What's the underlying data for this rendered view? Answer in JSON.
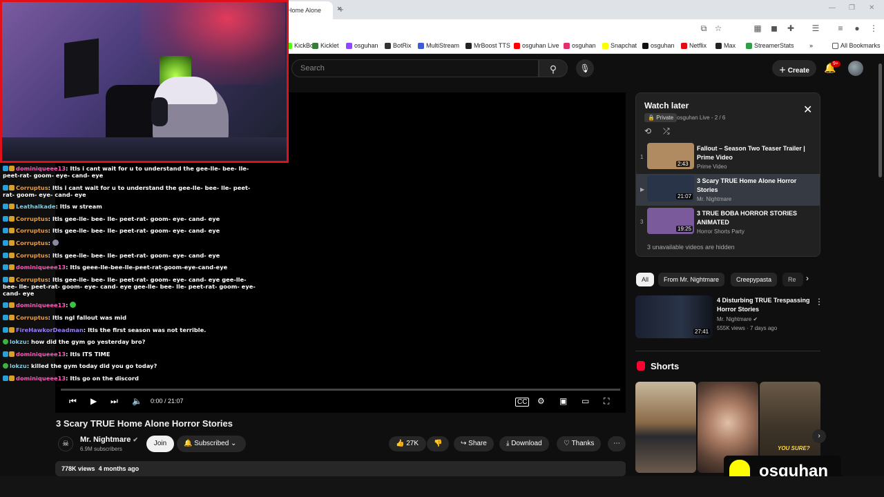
{
  "browser": {
    "tab_title": "Home Alone",
    "tab_close": "×",
    "new_tab": "+",
    "window_controls": [
      "—",
      "❐",
      "✕"
    ],
    "all_bookmarks": "All Bookmarks",
    "bookmarks": [
      {
        "label": "KickBot",
        "color": "#53fc18"
      },
      {
        "label": "Kicklet",
        "color": "#3a7a3a"
      },
      {
        "label": "osguhan",
        "color": "#9146ff"
      },
      {
        "label": "BotRix",
        "color": "#333333"
      },
      {
        "label": "MultiStream",
        "color": "#3b5bdb"
      },
      {
        "label": "MrBoost TTS",
        "color": "#222222"
      },
      {
        "label": "osguhan Live",
        "color": "#ff0000"
      },
      {
        "label": "osguhan",
        "color": "#e1306c"
      },
      {
        "label": "Snapchat",
        "color": "#fffc00"
      },
      {
        "label": "osguhan",
        "color": "#111111"
      },
      {
        "label": "Netflix",
        "color": "#e50914"
      },
      {
        "label": "Max",
        "color": "#222222"
      },
      {
        "label": "StreamerStats",
        "color": "#2f9e44"
      }
    ],
    "bookmark_overflow": "»"
  },
  "header": {
    "search_placeholder": "Search",
    "create_label": "Create",
    "notification_count": "9+"
  },
  "player": {
    "time": "0:00 / 21:07"
  },
  "chat": [
    {
      "user": "dominiqueee13",
      "color": "#ff5cbd",
      "text": "Itls i cant wait for u to understand the gee-lle- bee- lle- peet-rat- goom- eye- cand- eye"
    },
    {
      "user": "Corruptus",
      "color": "#e8a14a",
      "text": "Itls i cant wait for u to understand the gee-lle- bee- lle- peet-rat- goom- eye- cand- eye"
    },
    {
      "user": "Leathalkade",
      "color": "#7fd0e8",
      "text": "Itls w stream"
    },
    {
      "user": "Corruptus",
      "color": "#e8a14a",
      "text": "Itls gee-lle- bee- lle- peet-rat- goom- eye- cand- eye"
    },
    {
      "user": "Corruptus",
      "color": "#e8a14a",
      "text": "Itls gee-lle- bee- lle- peet-rat- goom- eye- cand- eye"
    },
    {
      "user": "Corruptus",
      "color": "#e8a14a",
      "text": ""
    },
    {
      "user": "Corruptus",
      "color": "#e8a14a",
      "text": "Itls gee-lle- bee- lle- peet-rat- goom- eye- cand- eye"
    },
    {
      "user": "dominiqueee13",
      "color": "#ff5cbd",
      "text": "Itls geee-lle-bee-lle-peet-rat-goom-eye-cand-eye"
    },
    {
      "user": "Corruptus",
      "color": "#e8a14a",
      "text": "Itls gee-lle- bee- lle- peet-rat- goom- eye- cand- eye gee-lle- bee- lle- peet-rat- goom- eye- cand- eye gee-lle- bee- lle- peet-rat- goom- eye- cand- eye"
    },
    {
      "user": "dominiqueee13",
      "color": "#ff5cbd",
      "text": ""
    },
    {
      "user": "Corruptus",
      "color": "#e8a14a",
      "text": "Itls ngl fallout was mid"
    },
    {
      "user": "FireHawkorDeadman",
      "color": "#9b7cff",
      "text": "Itls the first season was not terrible."
    },
    {
      "user": "lokzu",
      "color": "#7fd0e8",
      "text": "how did the gym go yesterday bro?"
    },
    {
      "user": "dominiqueee13",
      "color": "#ff5cbd",
      "text": "Itls ITS TIME"
    },
    {
      "user": "lokzu",
      "color": "#7fd0e8",
      "text": "killed the gym today did you go today?"
    },
    {
      "user": "dominiqueee13",
      "color": "#ff5cbd",
      "text": "Itls go on the discord"
    }
  ],
  "video": {
    "title": "3 Scary TRUE Home Alone Horror Stories",
    "channel": "Mr. Nightmare",
    "subscribers": "6.9M subscribers",
    "join_label": "Join",
    "subscribed_label": "Subscribed",
    "likes": "27K",
    "share_label": "Share",
    "download_label": "Download",
    "thanks_label": "Thanks",
    "views": "778K views",
    "age": "4 months ago"
  },
  "playlist": {
    "title": "Watch later",
    "privacy": "Private",
    "meta": "osguhan Live - 2 / 6",
    "hidden_note": "3 unavailable videos are hidden",
    "items": [
      {
        "index": "1",
        "title": "Fallout – Season Two Teaser Trailer | Prime Video",
        "channel": "Prime Video",
        "duration": "2:43",
        "thumb": "#b08a60"
      },
      {
        "index": "▶",
        "title": "3 Scary TRUE Home Alone Horror Stories",
        "channel": "Mr. Nightmare",
        "duration": "21:07",
        "thumb": "#2a3448"
      },
      {
        "index": "3",
        "title": "3 TRUE BOBA HORROR STORIES ANIMATED",
        "channel": "Horror Shorts Party",
        "duration": "19:25",
        "thumb": "#7a5a9a"
      }
    ]
  },
  "chips": [
    "All",
    "From Mr. Nightmare",
    "Creepypasta",
    "Re"
  ],
  "recommendation": {
    "title": "4 Disturbing TRUE Trespassing Horror Stories",
    "channel": "Mr. Nightmare",
    "stats": "555K views · 7 days ago",
    "duration": "27:41"
  },
  "shorts": {
    "title": "Shorts",
    "overlay_text": "YOU SURE?"
  },
  "snapchat_overlay": {
    "username": "osguhan"
  }
}
